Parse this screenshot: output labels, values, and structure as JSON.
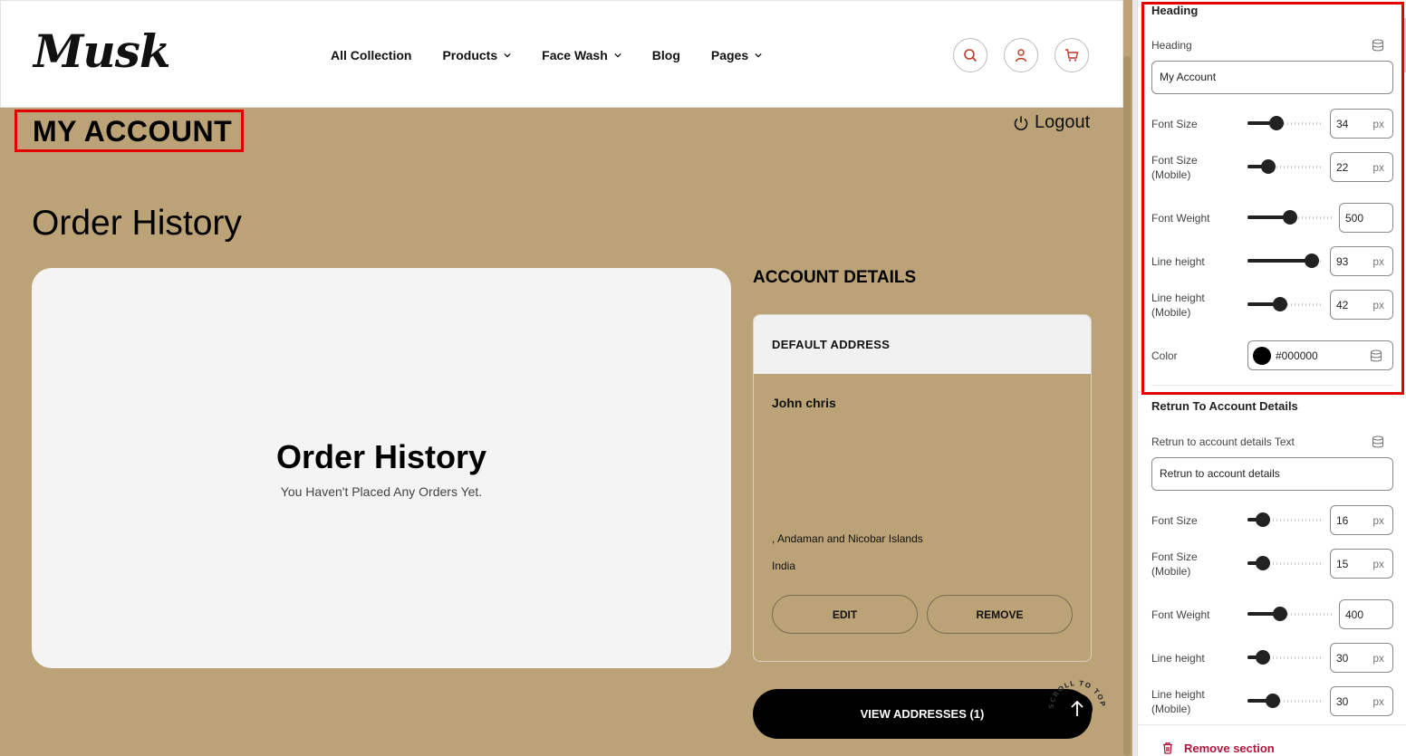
{
  "header": {
    "logo": "Musk",
    "nav": [
      {
        "label": "All Collection",
        "dropdown": false
      },
      {
        "label": "Products",
        "dropdown": true
      },
      {
        "label": "Face Wash",
        "dropdown": true
      },
      {
        "label": "Blog",
        "dropdown": false
      },
      {
        "label": "Pages",
        "dropdown": true
      }
    ],
    "icons": [
      "search-icon",
      "user-icon",
      "cart-icon"
    ]
  },
  "page": {
    "heading": "MY ACCOUNT",
    "logout": "Logout",
    "order_history_title": "Order History",
    "order_card_title": "Order History",
    "order_card_sub": "You Haven't Placed Any Orders Yet.",
    "account_details_title": "ACCOUNT DETAILS",
    "address": {
      "header": "DEFAULT ADDRESS",
      "name": "John chris",
      "region": ", Andaman and Nicobar Islands",
      "country": "India",
      "edit": "EDIT",
      "remove": "REMOVE"
    },
    "view_addresses": "VIEW ADDRESSES (1)",
    "scroll_to_top": "SCROLL TO TOP"
  },
  "panel": {
    "heading_section": {
      "title": "Heading",
      "heading_label": "Heading",
      "heading_value": "My Account",
      "font_size": {
        "label": "Font Size",
        "value": "34",
        "unit": "px",
        "level": 0.38
      },
      "font_size_mobile": {
        "label": "Font Size\n(Mobile)",
        "value": "22",
        "unit": "px",
        "level": 0.28
      },
      "font_weight": {
        "label": "Font Weight",
        "value": "500",
        "level": 0.5
      },
      "line_height": {
        "label": "Line height",
        "value": "93",
        "unit": "px",
        "level": 0.85
      },
      "line_height_mobile": {
        "label": "Line height\n(Mobile)",
        "value": "42",
        "unit": "px",
        "level": 0.43
      },
      "color": {
        "label": "Color",
        "value": "#000000"
      }
    },
    "return_section": {
      "title": "Retrun To Account Details",
      "text_label": "Retrun to account details Text",
      "text_value": "Retrun to account details",
      "font_size": {
        "label": "Font Size",
        "value": "16",
        "unit": "px",
        "level": 0.2
      },
      "font_size_mobile": {
        "label": "Font Size\n(Mobile)",
        "value": "15",
        "unit": "px",
        "level": 0.2
      },
      "font_weight": {
        "label": "Font Weight",
        "value": "400",
        "level": 0.39
      },
      "line_height": {
        "label": "Line height",
        "value": "30",
        "unit": "px",
        "level": 0.21
      },
      "line_height_mobile": {
        "label": "Line height\n(Mobile)",
        "value": "30",
        "unit": "px",
        "level": 0.34
      }
    },
    "remove_section": "Remove section"
  },
  "colors": {
    "page_bg": "#bba377",
    "highlight": "#e00000",
    "danger": "#b0173a"
  }
}
